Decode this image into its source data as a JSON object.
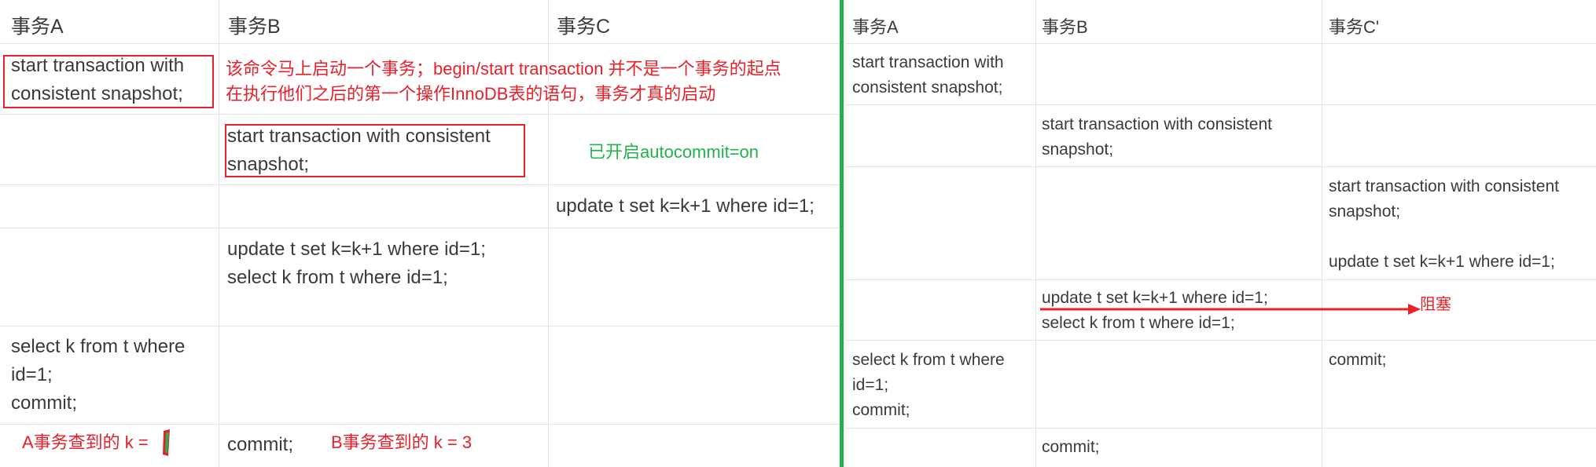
{
  "left": {
    "headers": [
      "事务A",
      "事务B",
      "事务C"
    ],
    "rows": [
      {
        "a": "start transaction with\nconsistent snapshot;",
        "b": "",
        "c": ""
      },
      {
        "a": "",
        "b": "start transaction with consistent\nsnapshot;",
        "c": ""
      },
      {
        "a": "",
        "b": "",
        "c": "update t set k=k+1 where id=1;"
      },
      {
        "a": "",
        "b": "update t set k=k+1 where id=1;\nselect k from t where id=1;",
        "c": ""
      },
      {
        "a": "select k from t where\nid=1;\ncommit;",
        "b": "",
        "c": ""
      },
      {
        "a": "",
        "b": "commit;",
        "c": ""
      }
    ],
    "annotations": {
      "note_red": "该命令马上启动一个事务；begin/start transaction 并不是一个事务的起点\n在执行他们之后的第一个操作InnoDB表的语句，事务才真的启动",
      "autocommit": "已开启autocommit=on",
      "a_result": "A事务查到的 k = ",
      "b_result": "B事务查到的 k = 3"
    }
  },
  "right": {
    "headers": [
      "事务A",
      "事务B",
      "事务C'"
    ],
    "rows": [
      {
        "a": "start transaction with\nconsistent snapshot;",
        "b": "",
        "c": ""
      },
      {
        "a": "",
        "b": "start transaction with consistent\nsnapshot;",
        "c": ""
      },
      {
        "a": "",
        "b": "",
        "c": "start transaction with consistent\nsnapshot;\n\nupdate t set k=k+1 where id=1;"
      },
      {
        "a": "",
        "b": "update t set k=k+1 where id=1;\nselect k from t where id=1;",
        "c": ""
      },
      {
        "a": "select k from t where\nid=1;\ncommit;",
        "b": "",
        "c": "commit;"
      },
      {
        "a": "",
        "b": "commit;",
        "c": ""
      }
    ],
    "annotations": {
      "blocked": "阻塞"
    }
  },
  "colors": {
    "accent_red": "#e8202a",
    "accent_green": "#22b24c",
    "grid": "#e2e2e2"
  }
}
